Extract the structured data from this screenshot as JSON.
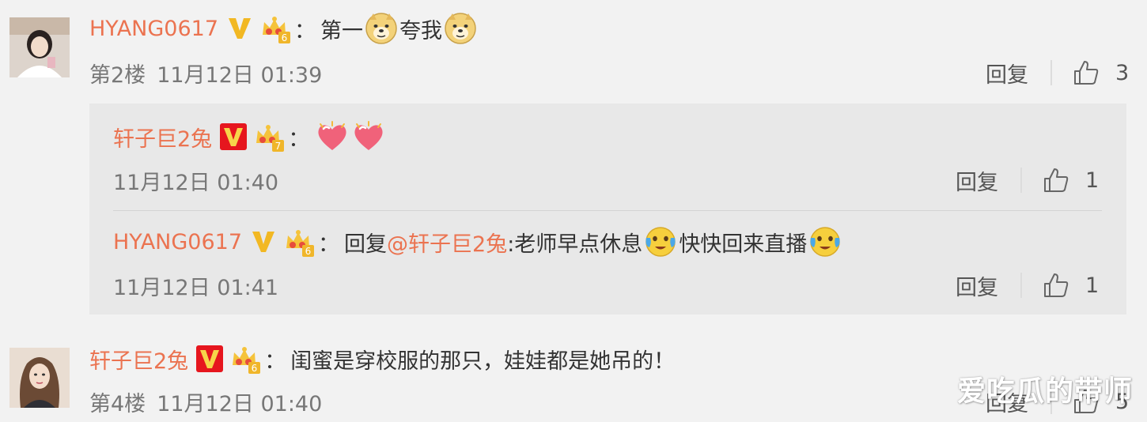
{
  "colors": {
    "username": "#eb7350",
    "background": "#f2f2f2",
    "sub_background": "#e8e8e8",
    "verified_red": "#e6161e",
    "verified_gold": "#f2b823"
  },
  "comments": [
    {
      "username": "HYANG0617",
      "verified": "gold-v-badge",
      "crown_level": "6",
      "colon": "：",
      "text_parts": [
        "第一",
        "夸我"
      ],
      "emojis": [
        "doge-icon",
        "doge-icon"
      ],
      "floor": "第2楼",
      "time": "11月12日 01:39",
      "reply_label": "回复",
      "likes": "3"
    },
    {
      "username": "轩子巨2兔",
      "verified": "red-v-badge",
      "crown_level": "6",
      "colon": "：",
      "text": "闺蜜是穿校服的那只，娃娃都是她吊的！",
      "floor": "第4楼",
      "time": "11月12日 01:40",
      "reply_label": "回复",
      "likes": "5"
    }
  ],
  "replies": [
    {
      "username": "轩子巨2兔",
      "verified": "red-v-badge",
      "crown_level": "7",
      "colon": "：",
      "emojis": [
        "heart-icon",
        "heart-icon"
      ],
      "time": "11月12日 01:40",
      "reply_label": "回复",
      "likes": "1"
    },
    {
      "username": "HYANG0617",
      "verified": "gold-v-badge",
      "crown_level": "6",
      "colon": "：",
      "prefix": "回复",
      "mention": "@轩子巨2兔",
      "text_a": ":老师早点休息",
      "text_b": "快快回来直播",
      "emojis": [
        "tearful-face-icon",
        "tearful-face-icon"
      ],
      "time": "11月12日 01:41",
      "reply_label": "回复",
      "likes": "1"
    }
  ],
  "watermark": "爱吃瓜的带师"
}
